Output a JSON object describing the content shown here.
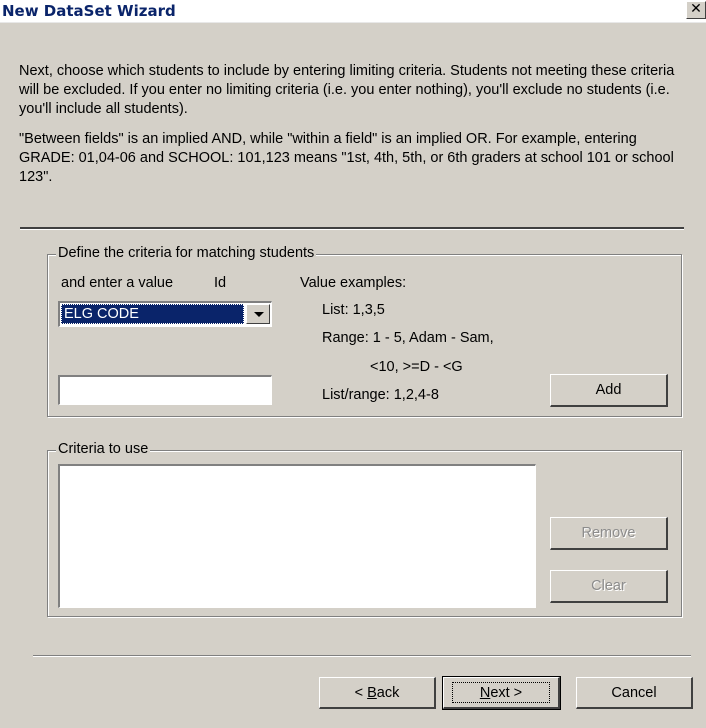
{
  "window": {
    "title": "New DataSet Wizard",
    "close_glyph": "✕"
  },
  "intro": {
    "para1": "Next, choose which students to include by entering limiting criteria.  Students not meeting these criteria will be excluded.  If you enter no limiting criteria (i.e. you enter nothing), you'll exclude no students (i.e. you'll include all students).",
    "para2": "\"Between fields\" is an implied AND, while \"within a field\" is an implied OR.  For example, entering GRADE: 01,04-06 and SCHOOL: 101,123 means \"1st, 4th, 5th, or 6th graders at school 101 or school 123\"."
  },
  "define_group": {
    "label": "Define the criteria for matching students",
    "enter_value_label": "and enter a value",
    "id_label": "Id",
    "field_select_value": "ELG CODE",
    "value_input": "",
    "examples_title": "Value examples:",
    "example_list": "List:  1,3,5",
    "example_range": "Range:  1 - 5, Adam - Sam,",
    "example_range2": "<10, >=D - <G",
    "example_listrange": "List/range:  1,2,4-8",
    "add_button": "Add"
  },
  "criteria_group": {
    "label": "Criteria to use",
    "items": [],
    "remove_button": "Remove",
    "clear_button": "Clear"
  },
  "footer": {
    "back_button_prefix": "< ",
    "back_button_accel": "B",
    "back_button_rest": "ack",
    "next_button_accel": "N",
    "next_button_rest": "ext >",
    "cancel_button": "Cancel"
  }
}
